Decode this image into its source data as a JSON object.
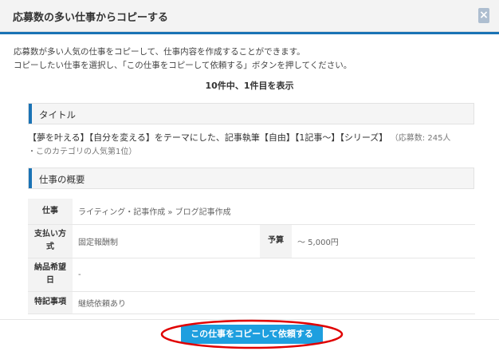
{
  "header": {
    "title": "応募数の多い仕事からコピーする",
    "close_label": "×"
  },
  "intro": {
    "line1": "応募数が多い人気の仕事をコピーして、仕事内容を作成することができます。",
    "line2": "コピーしたい仕事を選択し、「この仕事をコピーして依頼する」ボタンを押してください。"
  },
  "count_text": "10件中、1件目を表示",
  "sections": {
    "title_label": "タイトル",
    "overview_label": "仕事の概要"
  },
  "job": {
    "title": "【夢を叶える】【自分を変える】をテーマにした、記事執筆【自由】【1記事～】【シリーズ】",
    "meta_line1": "（応募数: 245人",
    "meta_line2": "・このカテゴリの人気第1位）"
  },
  "details": {
    "category_label": "仕事",
    "category_value": "ライティング・記事作成 » ブログ記事作成",
    "payment_label_l1": "支払い方",
    "payment_label_l2": "式",
    "payment_value": "固定報酬制",
    "budget_label": "予算",
    "budget_value": "～ 5,000円",
    "deadline_label_l1": "納品希望",
    "deadline_label_l2": "日",
    "deadline_value": "-",
    "notes_label": "特記事項",
    "notes_value": "継続依頼あり"
  },
  "footer": {
    "copy_button_label": "この仕事をコピーして依頼する"
  },
  "colors": {
    "accent": "#1a73b5",
    "button": "#1e9fdf",
    "annotation": "#e00000"
  }
}
